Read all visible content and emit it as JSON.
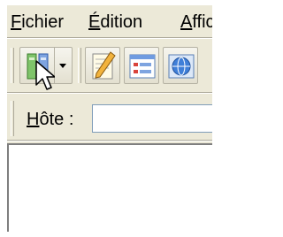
{
  "menubar": {
    "items": [
      {
        "label": "Fichier",
        "mnemonic": "F"
      },
      {
        "label": "Édition",
        "mnemonic": "É"
      },
      {
        "label": "Affic",
        "mnemonic": "A"
      }
    ]
  },
  "toolbar": {
    "buttons": [
      {
        "name": "connect",
        "icon": "connect-icon",
        "has_dropdown": true
      },
      {
        "name": "edit",
        "icon": "pencil-notepad-icon"
      },
      {
        "name": "properties",
        "icon": "form-list-icon"
      },
      {
        "name": "web",
        "icon": "globe-window-icon"
      }
    ]
  },
  "address": {
    "label": "Hôte :",
    "mnemonic": "H",
    "value": ""
  },
  "colors": {
    "chrome": "#ece9d8",
    "input_border": "#7f9db9",
    "content": "#ffffff"
  }
}
